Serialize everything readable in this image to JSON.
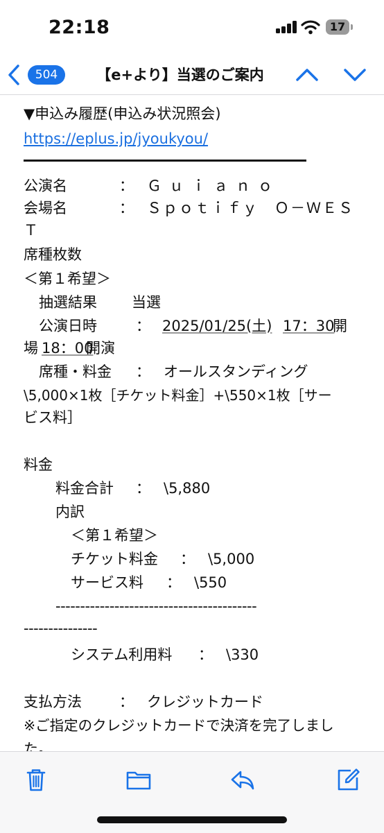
{
  "status_bar": {
    "time": "22:18",
    "battery": "17"
  },
  "nav": {
    "unread_count": "504",
    "title": "【e+より】当選のご案内"
  },
  "mail": {
    "lines": {
      "history_header": "▼申込み履歴(申込み状況照会)",
      "history_link": "https://eplus.jp/jyoukyou/",
      "perf_label": "公演名",
      "perf_sep": "：",
      "perf_value": "Ｇｕｉａｎｏ",
      "venue_label": "会場名",
      "venue_sep": "：",
      "venue_value": "Ｓｐｏｔｉｆｙ　Ｏ－ＷＥＳ",
      "venue_cont": "Ｔ",
      "seats": "席種枚数",
      "choice1": "＜第１希望＞",
      "lottery_label": "抽選結果",
      "lottery_value": "当選",
      "date_label": "公演日時",
      "date_sep": "：",
      "date_value": "2025/01/25(土)",
      "time_value": "17：30",
      "open_suffix": "開",
      "start_prefix": "場",
      "start_time": "18：00",
      "start_suffix": "開演",
      "seat_label": "席種・料金",
      "seat_sep": "：",
      "seat_value": "オールスタンディング",
      "price_line1": "\\5,000×1枚［チケット料金］+\\550×1枚［サー",
      "price_line2": "ビス料］",
      "fee_header": "料金",
      "total_label": "料金合計",
      "total_sep": "：",
      "total_value": "\\5,880",
      "breakdown": "内訳",
      "choice1b": "＜第１希望＞",
      "ticket_label": "チケット料金",
      "ticket_sep": "：",
      "ticket_value": "\\5,000",
      "service_label": "サービス料",
      "service_sep": "：",
      "service_value": "\\550",
      "dashes1": "-----------------------------------------",
      "dashes2": "---------------",
      "system_label": "システム利用料",
      "system_sep": "：",
      "system_value": "\\330",
      "payment_label": "支払方法",
      "payment_sep": "：",
      "payment_value": "クレジットカード",
      "note1": "※ご指定のクレジットカードで決済を完了しまし",
      "note2": "た。"
    }
  },
  "colors": {
    "accent": "#1a73e8",
    "link": "#1a6fe0",
    "text": "#111111"
  },
  "icons": [
    "back-chevron-icon",
    "previous-message-icon",
    "next-message-icon",
    "trash-icon",
    "folder-icon",
    "reply-icon",
    "compose-icon"
  ]
}
